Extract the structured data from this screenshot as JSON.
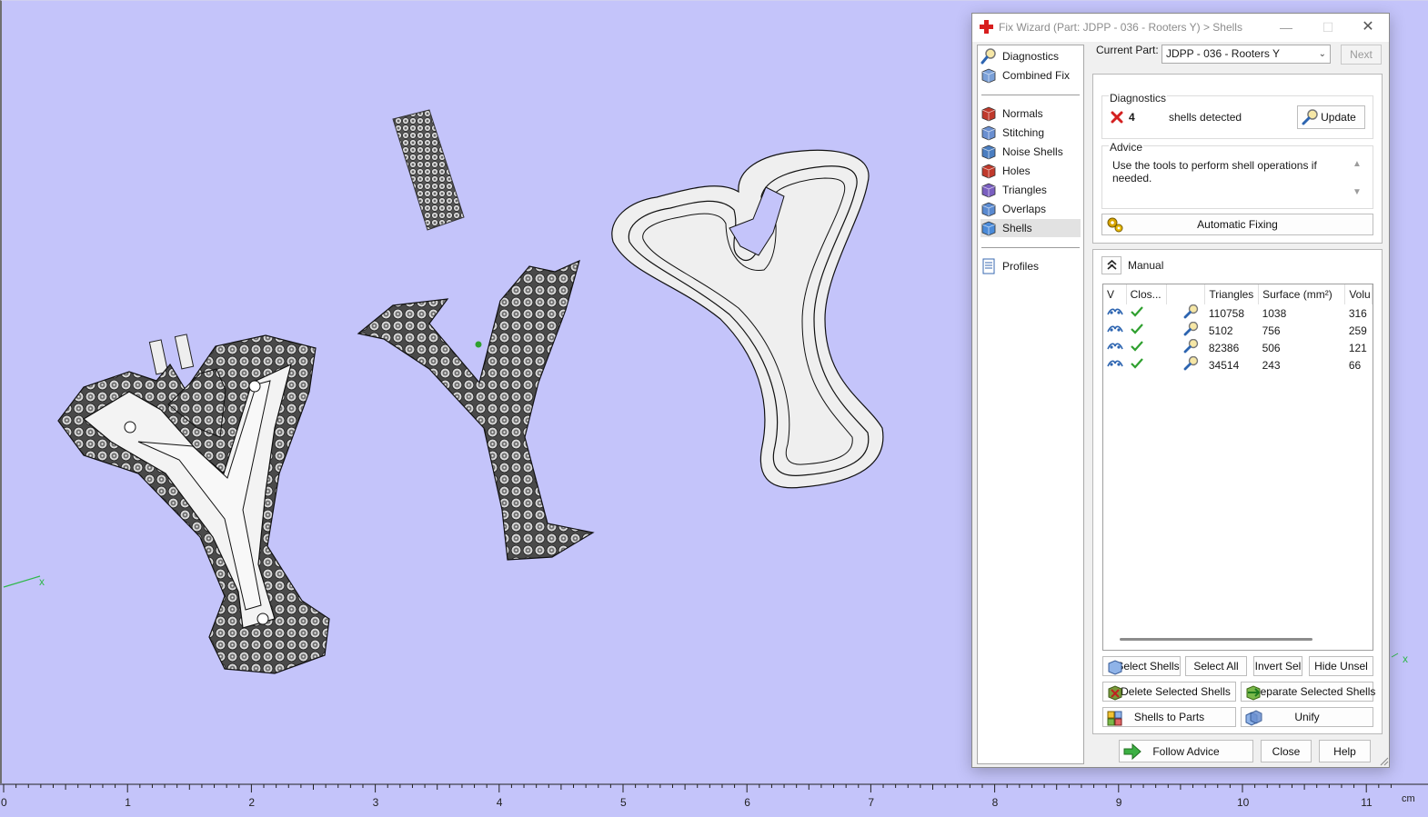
{
  "window": {
    "title": "Fix Wizard (Part: JDPP - 036 - Rooters Y) > Shells",
    "controls": {
      "minimize": "—",
      "maximize": "☐",
      "close": "✕"
    }
  },
  "nav": {
    "top": [
      {
        "label": "Diagnostics",
        "icon": "diagnostics-icon"
      },
      {
        "label": "Combined Fix",
        "icon": "combined-fix-icon"
      }
    ],
    "fixes": [
      {
        "label": "Normals",
        "icon": "normals-icon"
      },
      {
        "label": "Stitching",
        "icon": "stitching-icon"
      },
      {
        "label": "Noise Shells",
        "icon": "noise-shells-icon"
      },
      {
        "label": "Holes",
        "icon": "holes-icon"
      },
      {
        "label": "Triangles",
        "icon": "triangles-icon"
      },
      {
        "label": "Overlaps",
        "icon": "overlaps-icon"
      },
      {
        "label": "Shells",
        "icon": "shells-icon",
        "active": true
      }
    ],
    "bottom": [
      {
        "label": "Profiles",
        "icon": "profiles-icon"
      }
    ]
  },
  "header": {
    "current_part_label": "Current Part:",
    "current_part_value": "JDPP - 036 - Rooters Y",
    "next_label": "Next"
  },
  "diagnostics": {
    "title": "Diagnostics",
    "count": "4",
    "status_text": "shells detected",
    "update_label": "Update",
    "status_color": "#d42020"
  },
  "advice": {
    "title": "Advice",
    "text": "Use the tools to perform shell operations if needed.",
    "auto_fix_label": "Automatic Fixing"
  },
  "manual": {
    "title": "Manual",
    "columns": [
      "V",
      "Clos...",
      "",
      "Triangles",
      "Surface (mm²)",
      "Volu"
    ],
    "rows": [
      {
        "triangles": "110758",
        "surface": "1038",
        "volume": "316"
      },
      {
        "triangles": "5102",
        "surface": "756",
        "volume": "259"
      },
      {
        "triangles": "82386",
        "surface": "506",
        "volume": "121"
      },
      {
        "triangles": "34514",
        "surface": "243",
        "volume": "66"
      }
    ],
    "buttons": {
      "select_shells": "Select Shells",
      "select_all": "Select All",
      "invert_sel": "Invert Sel",
      "hide_unsel": "Hide Unsel",
      "delete_selected": "Delete Selected Shells",
      "separate_selected": "Separate Selected Shells",
      "shells_to_parts": "Shells to Parts",
      "unify": "Unify"
    }
  },
  "footer": {
    "follow_advice": "Follow Advice",
    "close": "Close",
    "help": "Help"
  },
  "ruler": {
    "unit": "cm",
    "labels": [
      "0",
      "1",
      "2",
      "3",
      "4",
      "5",
      "6",
      "7",
      "8",
      "9",
      "10",
      "11"
    ]
  },
  "scene": {
    "axis_label": "x",
    "background_color": "#c4c4fa",
    "check_color": "#2fa02f"
  }
}
